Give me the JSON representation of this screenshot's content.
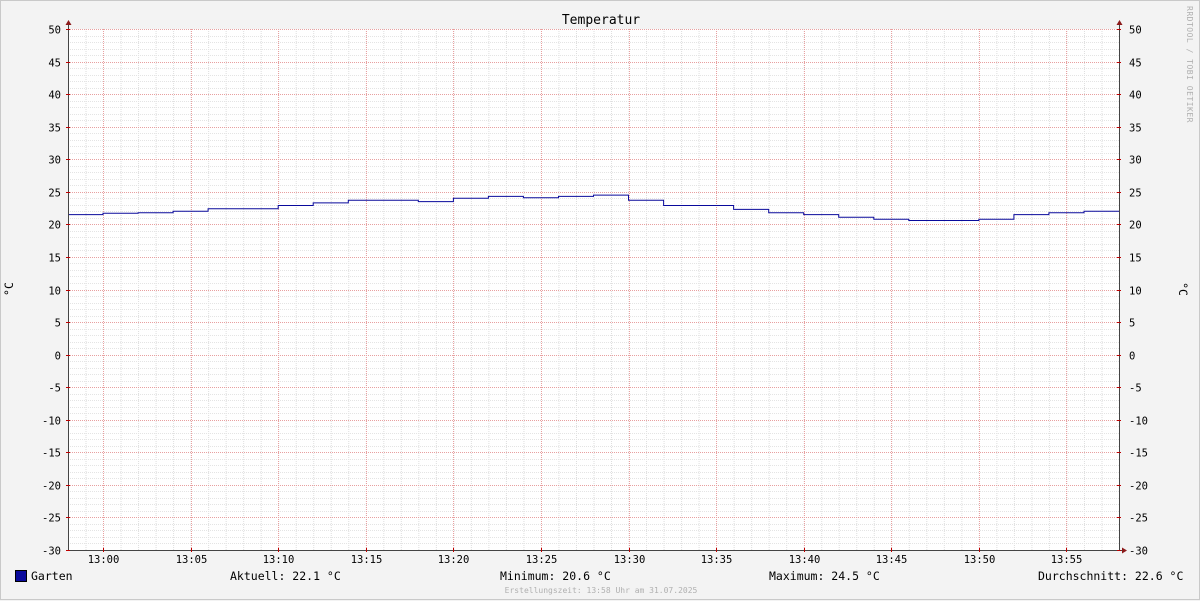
{
  "chart_data": {
    "type": "line",
    "title": "Temperatur",
    "ylabel": "°C",
    "ylabel_right": "°C",
    "watermark": "RRDTOOL / TOBI OETIKER",
    "ylim": [
      -30,
      50
    ],
    "yticks": [
      50,
      45,
      40,
      35,
      30,
      25,
      20,
      15,
      10,
      5,
      0,
      -5,
      -10,
      -15,
      -20,
      -25,
      -30
    ],
    "xlim": [
      "12:58",
      "13:58"
    ],
    "xticks": [
      "13:00",
      "13:05",
      "13:10",
      "13:15",
      "13:20",
      "13:25",
      "13:30",
      "13:35",
      "13:40",
      "13:45",
      "13:50",
      "13:55"
    ],
    "grid": true,
    "series": [
      {
        "name": "Garten",
        "color": "#0a0a9c",
        "step": true,
        "x": [
          "12:58",
          "13:00",
          "13:02",
          "13:04",
          "13:06",
          "13:08",
          "13:10",
          "13:12",
          "13:14",
          "13:16",
          "13:18",
          "13:20",
          "13:22",
          "13:24",
          "13:26",
          "13:28",
          "13:30",
          "13:32",
          "13:34",
          "13:36",
          "13:38",
          "13:40",
          "13:42",
          "13:44",
          "13:46",
          "13:48",
          "13:50",
          "13:52",
          "13:54",
          "13:56"
        ],
        "values": [
          21.5,
          21.7,
          21.8,
          22.0,
          22.4,
          22.4,
          22.9,
          23.3,
          23.7,
          23.7,
          23.5,
          24.0,
          24.3,
          24.1,
          24.3,
          24.5,
          23.7,
          22.9,
          22.9,
          22.3,
          21.8,
          21.5,
          21.1,
          20.8,
          20.6,
          20.6,
          20.8,
          21.5,
          21.8,
          22.0
        ]
      }
    ],
    "legend": {
      "position": "bottom-left",
      "entries": [
        "Garten"
      ]
    },
    "stats": {
      "current_label": "Aktuell: 22.1 °C",
      "minimum_label": "Minimum: 20.6 °C",
      "maximum_label": "Maximum: 24.5 °C",
      "average_label": "Durchschnitt: 22.6 °C"
    },
    "footer": "Erstellungszeit: 13:58 Uhr am 31.07.2025"
  }
}
